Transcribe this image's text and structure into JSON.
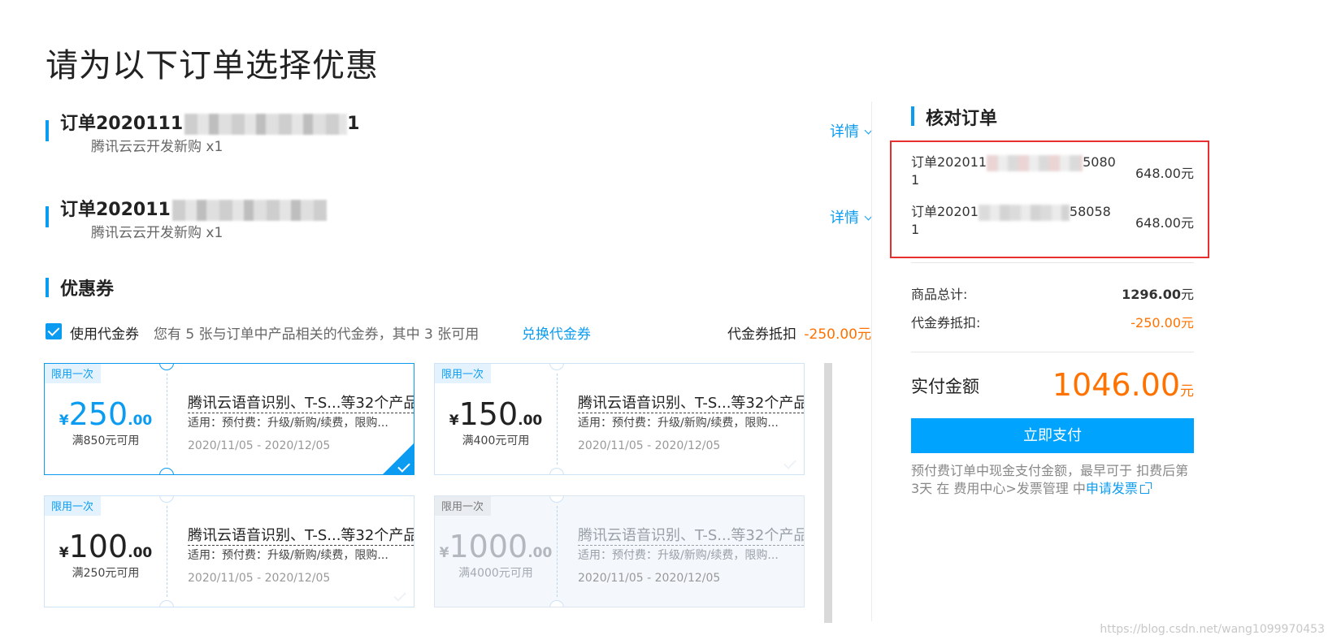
{
  "page": {
    "title": "请为以下订单选择优惠"
  },
  "orders": [
    {
      "order_no": "订单2020111",
      "order_suffix": "1",
      "product": "腾讯云云开发新购 x1",
      "detail_label": "详情"
    },
    {
      "order_no": "订单202011",
      "order_suffix": "",
      "product": "腾讯云云开发新购 x1",
      "detail_label": "详情"
    }
  ],
  "coupons_section": {
    "title": "优惠券",
    "use_label": "使用代金券",
    "info": "您有 5 张与订单中产品相关的代金券，其中 3 张可用",
    "exchange_label": "兑换代金券",
    "deduct_label": "代金券抵扣",
    "deduct_value": "-250.00元",
    "use_checked": true
  },
  "coupons": [
    {
      "tag": "限用一次",
      "currency": "¥",
      "amount_int": "250",
      "amount_dec": ".00",
      "condition": "满850元可用",
      "title": "腾讯云语音识别、T-S...等32个产品",
      "scope": "适用：预付费：升级/新购/续费，限购...",
      "date": "2020/11/05 - 2020/12/05",
      "state": "selected"
    },
    {
      "tag": "限用一次",
      "currency": "¥",
      "amount_int": "150",
      "amount_dec": ".00",
      "condition": "满400元可用",
      "title": "腾讯云语音识别、T-S...等32个产品",
      "scope": "适用：预付费：升级/新购/续费，限购...",
      "date": "2020/11/05 - 2020/12/05",
      "state": "available"
    },
    {
      "tag": "限用一次",
      "currency": "¥",
      "amount_int": "100",
      "amount_dec": ".00",
      "condition": "满250元可用",
      "title": "腾讯云语音识别、T-S...等32个产品",
      "scope": "适用：预付费：升级/新购/续费，限购...",
      "date": "2020/11/05 - 2020/12/05",
      "state": "available"
    },
    {
      "tag": "限用一次",
      "currency": "¥",
      "amount_int": "1000",
      "amount_dec": ".00",
      "condition": "满4000元可用",
      "title": "腾讯云语音识别、T-S...等32个产品",
      "scope": "适用：预付费：升级/新购/续费，限购...",
      "date": "2020/11/05 - 2020/12/05",
      "state": "disabled"
    }
  ],
  "summary": {
    "title": "核对订单",
    "orders": [
      {
        "no_prefix": "订单202011",
        "no_suffix": "5080",
        "no_line2": "1",
        "price": "648.00元"
      },
      {
        "no_prefix": "订单20201",
        "no_suffix": "58058",
        "no_line2": "1",
        "price": "648.00元"
      }
    ],
    "total_label": "商品总计:",
    "total_value": "1296.00",
    "total_unit": "元",
    "coupon_label": "代金券抵扣:",
    "coupon_value": "-250.00元",
    "pay_label": "实付金额",
    "pay_value": "1046.00",
    "pay_unit": "元",
    "pay_button": "立即支付",
    "note_text": "预付费订单中现金支付金额，最早可于 扣费后第3天 在 费用中心>发票管理 中",
    "note_link": "申请发票"
  },
  "watermark": "https://blog.csdn.net/wang1099970453",
  "colors": {
    "accent": "#0b9cf2",
    "price": "#ff7200",
    "highlight_box": "#e62f2f"
  }
}
